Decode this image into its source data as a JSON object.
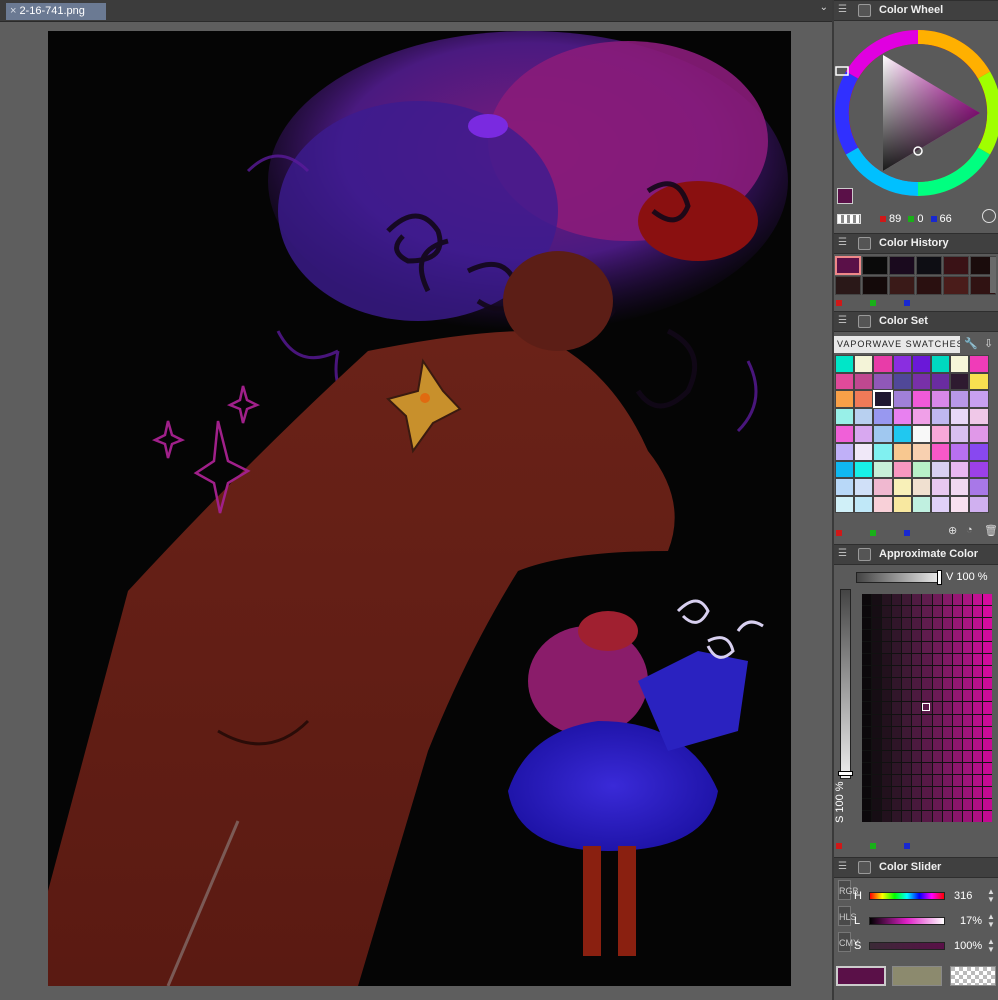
{
  "document": {
    "tab_title": "2-16-741.png",
    "close_glyph": "×",
    "menu_glyph": "⌄"
  },
  "color_wheel": {
    "title": "Color Wheel",
    "current_color": "#5a1048",
    "rgb": {
      "r": "89",
      "g": "0",
      "b": "66"
    }
  },
  "color_history": {
    "title": "Color History",
    "colors": [
      "#5a1048",
      "#0a0a0a",
      "#1a0a1e",
      "#0e0e14",
      "#3a1216",
      "#1a0c0c",
      "#2a1818",
      "#140a0a",
      "#3a1a18",
      "#2a1010",
      "#4a1c1a",
      "#301212"
    ]
  },
  "color_set": {
    "title": "Color Set",
    "set_name": "VAPORWAVE SWATCHES",
    "swatches": [
      "#00e6c8",
      "#f4f4d8",
      "#e83ca8",
      "#8a2ee0",
      "#6a18d8",
      "#00d8c0",
      "#f6f6d8",
      "#f03cb8",
      "#e04a9a",
      "#c04890",
      "#9058b8",
      "#504898",
      "#7830a8",
      "#6a2ca0",
      "#2e1a30",
      "#f8e050",
      "#f8a048",
      "#f07a58",
      "#201830",
      "#a080d8",
      "#f05ad8",
      "#d888e8",
      "#b898e8",
      "#c8a0f0",
      "#98f0e8",
      "#b8d0f0",
      "#9898f0",
      "#e880f0",
      "#f0a0e8",
      "#c0b8f0",
      "#e8d8f8",
      "#f0c8e8",
      "#f060d8",
      "#d8a8f0",
      "#a0c8f0",
      "#20c8f0",
      "#f8f8f8",
      "#f8a8d8",
      "#d8c0f0",
      "#e098e8",
      "#c0b0f8",
      "#f0e8f8",
      "#80f0f0",
      "#f8c890",
      "#f8d0b0",
      "#f858c8",
      "#b870f0",
      "#8848f0",
      "#10b8f0",
      "#18f0e8",
      "#c8f0d8",
      "#f898c0",
      "#b8f0c8",
      "#d8d0f0",
      "#e8b8f0",
      "#9c40e8",
      "#b8d8f8",
      "#d0e0f8",
      "#f0b8d0",
      "#f8f0b8",
      "#f0e0d0",
      "#e8c8f0",
      "#f0d8f0",
      "#a878e8",
      "#d0f0f8",
      "#c0e8f8",
      "#f8d0d8",
      "#f8e8a0",
      "#c0f0e0",
      "#e0d0f8",
      "#f8e0f0",
      "#d0b0f0"
    ]
  },
  "approximate_color": {
    "title": "Approximate Color",
    "v_label": "V 100 %",
    "s_label": "S 100 %"
  },
  "color_slider": {
    "title": "Color Slider",
    "modes": [
      "RGB",
      "HLS",
      "CMY"
    ],
    "h_label": "H",
    "h_value": "316",
    "l_label": "L",
    "l_value": "17%",
    "s_label": "S",
    "s_value": "100%",
    "main_color": "#5a1048",
    "sub_color": "#8c8a6e"
  }
}
